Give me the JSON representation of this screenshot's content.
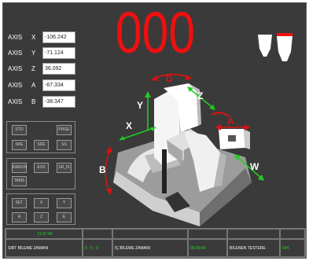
{
  "counter": "000",
  "axes": [
    {
      "label": "AXIS",
      "letter": "X",
      "value": "-106.242"
    },
    {
      "label": "AXIS",
      "letter": "Y",
      "value": "-71.124"
    },
    {
      "label": "AXIS",
      "letter": "Z",
      "value": "36.092"
    },
    {
      "label": "AXIS",
      "letter": "A",
      "value": "-67.334"
    },
    {
      "label": "AXIS",
      "letter": "B",
      "value": "-38.347"
    }
  ],
  "robot_axis_labels": {
    "x": "X",
    "y": "Y",
    "z": "Z",
    "a": "A",
    "b": "B",
    "d": "D",
    "w": "W"
  },
  "button_groups": {
    "group1": [
      "STO",
      "PRGE",
      "SKE",
      "SDE",
      "SS"
    ],
    "group2": [
      "ERRON",
      "EXS",
      "SR_IS",
      "TAMS"
    ],
    "group3": [
      "SET",
      "X",
      "Y",
      "A",
      "Z",
      "E"
    ]
  },
  "status_bar": {
    "clock": "11:37:40",
    "sirt_label": "SIRT BİLEME ZAMANI",
    "sirt_value": "0 : 5 : 0",
    "ic_label": "İÇ BİLEME ZAMANI",
    "ic_value": "00:00:00",
    "tested_label": "BİLENEN TESTERE",
    "tested_value": "024"
  },
  "colors": {
    "counter": "#ee1010",
    "axis_arrow_green": "#22cc22",
    "axis_arrow_red": "#dd1111",
    "status_value": "#22dd22"
  },
  "icons": [
    "tool-white-icon",
    "tool-red-tipped-icon",
    "robot-arm-icon"
  ]
}
